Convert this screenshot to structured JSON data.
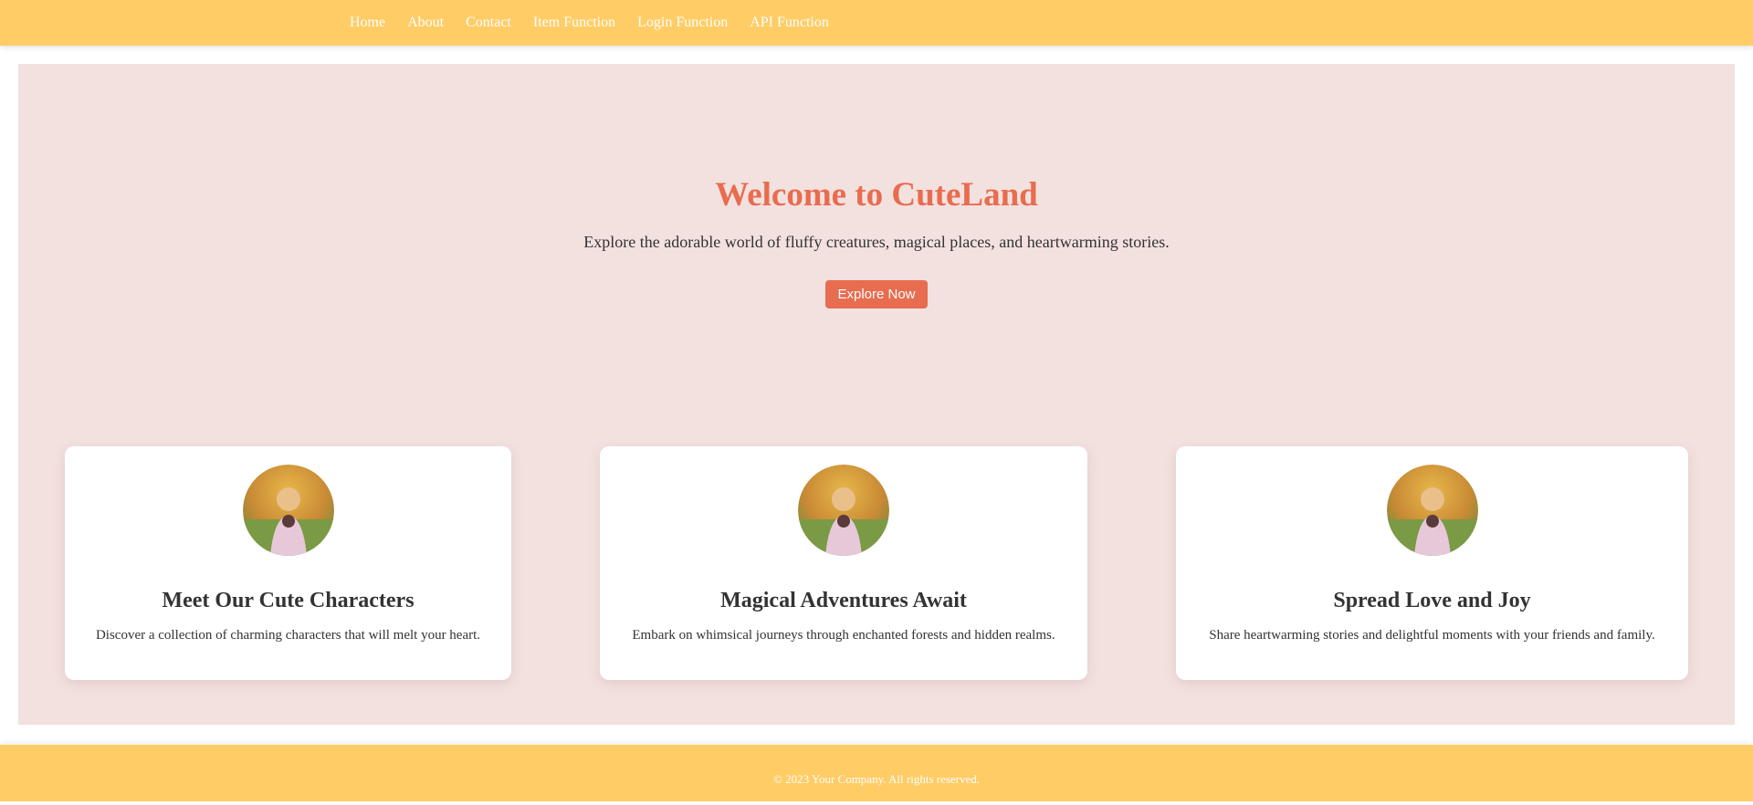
{
  "nav": {
    "items": [
      {
        "label": "Home"
      },
      {
        "label": "About"
      },
      {
        "label": "Contact"
      },
      {
        "label": "Item Function"
      },
      {
        "label": "Login Function"
      },
      {
        "label": "API Function"
      }
    ]
  },
  "hero": {
    "title": "Welcome to CuteLand",
    "subtitle": "Explore the adorable world of fluffy creatures, magical places, and heartwarming stories.",
    "button_label": "Explore Now"
  },
  "cards": [
    {
      "title": "Meet Our Cute Characters",
      "text": "Discover a collection of charming characters that will melt your heart."
    },
    {
      "title": "Magical Adventures Await",
      "text": "Embark on whimsical journeys through enchanted forests and hidden realms."
    },
    {
      "title": "Spread Love and Joy",
      "text": "Share heartwarming stories and delightful moments with your friends and family."
    }
  ],
  "footer": {
    "text": "© 2023 Your Company. All rights reserved."
  },
  "colors": {
    "nav_background": "#ffcc66",
    "panel_background": "#f3e1df",
    "accent": "#e86c4f",
    "card_background": "#ffffff"
  }
}
